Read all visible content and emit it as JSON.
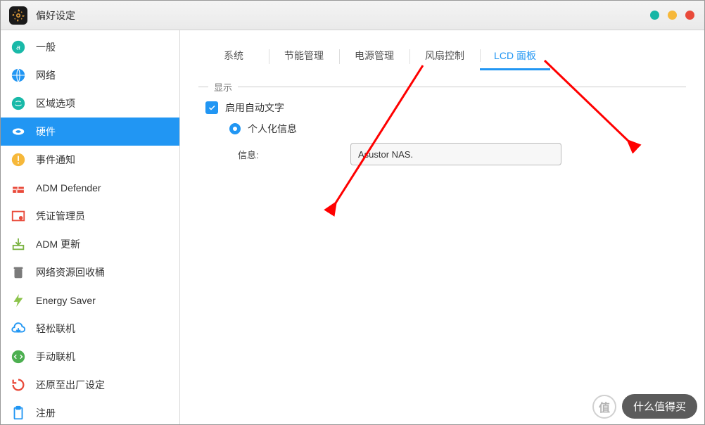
{
  "titlebar": {
    "title": "偏好设定"
  },
  "sidebar": {
    "items": [
      {
        "id": "general",
        "label": "一般",
        "active": false,
        "color": "#19b9a8"
      },
      {
        "id": "network",
        "label": "网络",
        "active": false,
        "color": "#2196f3"
      },
      {
        "id": "regional",
        "label": "区域选项",
        "active": false,
        "color": "#19b9a8"
      },
      {
        "id": "hardware",
        "label": "硬件",
        "active": true,
        "color": "#ffffff"
      },
      {
        "id": "event",
        "label": "事件通知",
        "active": false,
        "color": "#f6b83a"
      },
      {
        "id": "defender",
        "label": "ADM Defender",
        "active": false,
        "color": "#e94a3a"
      },
      {
        "id": "cert",
        "label": "凭证管理员",
        "active": false,
        "color": "#e94a3a"
      },
      {
        "id": "update",
        "label": "ADM 更新",
        "active": false,
        "color": "#7bb342"
      },
      {
        "id": "recycle",
        "label": "网络资源回收桶",
        "active": false,
        "color": "#7a7a7a"
      },
      {
        "id": "energy",
        "label": "Energy Saver",
        "active": false,
        "color": "#8bc34a"
      },
      {
        "id": "ezconnect",
        "label": "轻松联机",
        "active": false,
        "color": "#2196f3"
      },
      {
        "id": "manual",
        "label": "手动联机",
        "active": false,
        "color": "#4caf50"
      },
      {
        "id": "factory",
        "label": "还原至出厂设定",
        "active": false,
        "color": "#e94a3a"
      },
      {
        "id": "register",
        "label": "注册",
        "active": false,
        "color": "#2196f3"
      }
    ]
  },
  "tabs": [
    {
      "id": "system",
      "label": "系统",
      "active": false
    },
    {
      "id": "power-saving",
      "label": "节能管理",
      "active": false
    },
    {
      "id": "power-mgmt",
      "label": "电源管理",
      "active": false
    },
    {
      "id": "fan",
      "label": "风扇控制",
      "active": false
    },
    {
      "id": "lcd",
      "label": "LCD 面板",
      "active": false
    }
  ],
  "active_tab_label": "LCD 面板",
  "section": {
    "title": "显示"
  },
  "form": {
    "enable_scroll_label": "启用自动文字",
    "enable_scroll_checked": true,
    "custom_info_label": "个人化信息",
    "custom_info_selected": true,
    "info_label": "信息:",
    "info_value": "Asustor NAS."
  },
  "watermark": {
    "badge": "值",
    "text": "什么值得买"
  }
}
